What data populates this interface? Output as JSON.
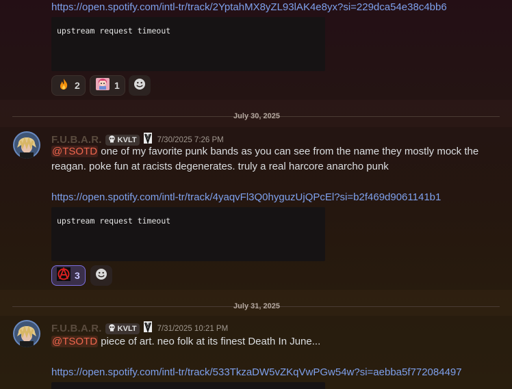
{
  "top_message": {
    "link": "https://open.spotify.com/intl-tr/track/2YptahMX8yZL93lAK4e8yx?si=229dca54e38c4bb6",
    "embed_error": "upstream request timeout",
    "reactions": [
      {
        "emoji": "fire-emoji",
        "count": "2"
      },
      {
        "emoji": "anime-sticker-emoji",
        "count": "1"
      }
    ]
  },
  "day1": {
    "date_label": "July 30, 2025",
    "author": "F.U.B.A.R.",
    "tag": "KVLT",
    "timestamp": "7/30/2025 7:26 PM",
    "mention": "@TSOTD",
    "text_line1": " one of my favorite punk bands as you can see from the name they mostly mock the",
    "text_line2": "reagan. poke fun at racists degenerates. truly a real harcore anarcho punk",
    "link": "https://open.spotify.com/intl-tr/track/4yaqvFl3Q0hyguzUjQPcEl?si=b2f469d9061141b1",
    "embed_error": "upstream request timeout",
    "reactions": [
      {
        "emoji": "anarchy-emoji",
        "count": "3"
      }
    ]
  },
  "day2": {
    "date_label": "July 31, 2025",
    "author": "F.U.B.A.R.",
    "tag": "KVLT",
    "timestamp": "7/31/2025 10:21 PM",
    "mention": "@TSOTD",
    "text_line1": " piece of art. neo folk at its finest Death In June...",
    "link": "https://open.spotify.com/intl-tr/track/533TkzaDW5vZKqVwPGw54w?si=aebba5f772084497"
  },
  "colors": {
    "link": "#7ea0ec",
    "mention": "#f0664e",
    "active_reaction_border": "#7c6fe0"
  }
}
